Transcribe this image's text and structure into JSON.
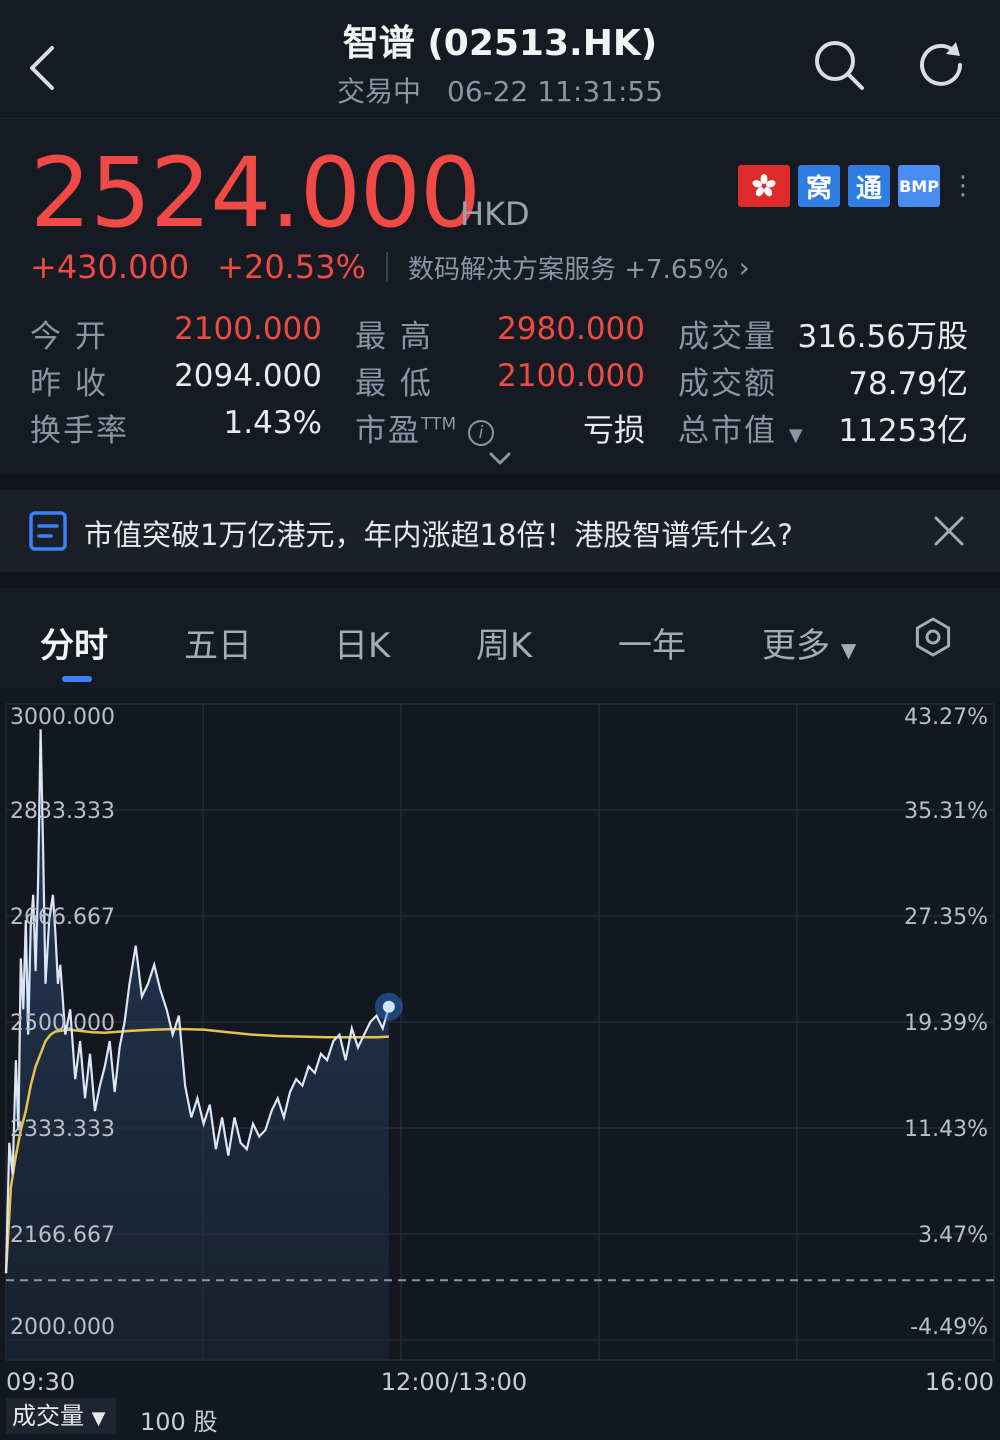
{
  "header": {
    "title": "智谱 (02513.HK)",
    "status": "交易中",
    "datetime": "06-22 11:31:55",
    "icons": {
      "back": "chevron-left-icon",
      "search": "search-icon",
      "refresh": "refresh-icon"
    }
  },
  "quote": {
    "price": "2524.000",
    "currency": "HKD",
    "change": "+430.000",
    "change_pct": "+20.53%",
    "sector": "数码解决方案服务 +7.65%",
    "badges": [
      "窝",
      "通",
      "BMP"
    ],
    "colors": {
      "up": "#ef4a45",
      "accent": "#3b82f6"
    }
  },
  "stats": {
    "open_label": "今 开",
    "open": "2100.000",
    "high_label": "最 高",
    "high": "2980.000",
    "volume_label": "成交量",
    "volume": "316.56万股",
    "prev_close_label": "昨 收",
    "prev_close": "2094.000",
    "low_label": "最 低",
    "low": "2100.000",
    "turnover_label": "成交额",
    "turnover": "78.79亿",
    "turnover_rate_label": "换手率",
    "turnover_rate": "1.43%",
    "pe_label": "市盈",
    "pe_sup": "TTM",
    "pe": "亏损",
    "mktcap_label": "总市值",
    "mktcap": "11253亿"
  },
  "news": {
    "text": "市值突破1万亿港元，年内涨超18倍！港股智谱凭什么?"
  },
  "tabs": [
    "分时",
    "五日",
    "日K",
    "周K",
    "一年",
    "更多"
  ],
  "chart_data": {
    "type": "line",
    "y_labels_left": [
      "3000.000",
      "2833.333",
      "2666.667",
      "2500.000",
      "2333.333",
      "2166.667",
      "2000.000"
    ],
    "y_labels_right": [
      "43.27%",
      "35.31%",
      "27.35%",
      "19.39%",
      "11.43%",
      "3.47%",
      "-4.49%"
    ],
    "x_labels": [
      "09:30",
      "12:00/13:00",
      "16:00"
    ],
    "ylim": [
      2000,
      3000
    ],
    "prev_close": 2094,
    "series": [
      {
        "x": [
          0.0,
          0.8,
          1.6,
          2.4,
          3.0,
          3.6,
          4.2,
          4.8,
          5.4,
          6.0,
          6.6,
          7.2,
          7.8,
          8.4,
          9.0,
          9.6,
          10.5,
          11.4,
          12.0,
          12.6,
          13.2,
          14.4,
          15.6,
          16.8,
          18.0,
          19.2,
          20.4,
          21.6,
          22.8,
          24.0,
          25.2,
          26.4,
          27.6,
          28.8,
          30.0,
          31.5,
          33.0,
          34.5,
          36.0,
          37.5,
          39.0,
          40.5,
          42.0,
          43.5,
          45.0,
          46.5,
          48.0,
          49.5,
          51.0,
          52.5,
          54.0,
          55.5,
          57.0,
          58.5,
          60.0,
          61.5,
          63.0,
          64.5,
          66.0,
          67.5,
          69.0,
          70.5,
          72.0,
          73.5,
          75.0,
          76.5,
          78.0,
          79.5,
          81.0,
          82.5,
          84.0,
          85.5,
          87.0,
          88.5,
          90.0,
          91.5,
          93.0
        ],
        "values": [
          2105,
          2310,
          2260,
          2440,
          2330,
          2600,
          2520,
          2660,
          2480,
          2650,
          2700,
          2580,
          2720,
          2960,
          2780,
          2560,
          2660,
          2700,
          2640,
          2560,
          2590,
          2480,
          2520,
          2410,
          2470,
          2380,
          2450,
          2360,
          2400,
          2430,
          2470,
          2390,
          2460,
          2500,
          2560,
          2620,
          2540,
          2560,
          2590,
          2550,
          2520,
          2480,
          2510,
          2400,
          2350,
          2380,
          2340,
          2370,
          2300,
          2350,
          2290,
          2350,
          2310,
          2300,
          2340,
          2320,
          2330,
          2360,
          2380,
          2350,
          2390,
          2410,
          2400,
          2430,
          2420,
          2450,
          2440,
          2470,
          2480,
          2440,
          2490,
          2460,
          2480,
          2500,
          2510,
          2490,
          2524
        ]
      },
      {
        "x": [
          0.0,
          1.2,
          2.4,
          3.6,
          4.8,
          6.0,
          7.2,
          8.4,
          9.6,
          10.8,
          12.0,
          13.2,
          15.0,
          18.0,
          21.0,
          24.0,
          30.0,
          36.0,
          42.0,
          48.0,
          54.0,
          60.0,
          66.0,
          72.0,
          78.0,
          84.0,
          90.0,
          93.0
        ],
        "values": [
          2105,
          2240,
          2290,
          2330,
          2360,
          2400,
          2430,
          2450,
          2470,
          2480,
          2485,
          2486,
          2488,
          2486,
          2484,
          2483,
          2486,
          2488,
          2489,
          2488,
          2484,
          2480,
          2478,
          2477,
          2476,
          2476,
          2476,
          2477
        ]
      }
    ],
    "x_range": [
      0,
      240
    ]
  },
  "volume": {
    "label": "成交量",
    "unit": "100 股"
  }
}
